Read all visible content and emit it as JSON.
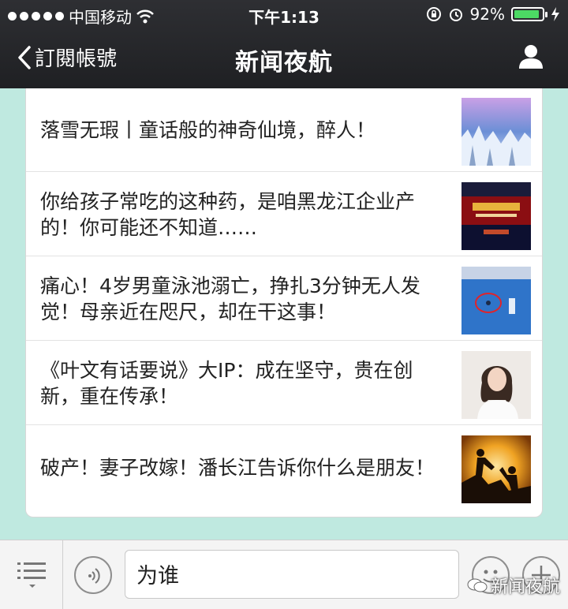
{
  "status_bar": {
    "carrier": "中国移动",
    "time": "下午1:13",
    "battery_percent_label": "92%",
    "battery_level": 0.92,
    "icons": [
      "signal-dots-icon",
      "wifi-icon",
      "rotation-lock-icon",
      "alarm-icon",
      "battery-icon",
      "charging-icon"
    ]
  },
  "nav": {
    "back_label": "訂閱帳號",
    "title": "新闻夜航",
    "right_icon": "person-icon"
  },
  "articles": [
    {
      "title": "落雪无瑕丨童话般的神奇仙境，醉人！",
      "thumb": "snowy-trees-image"
    },
    {
      "title": "你给孩子常吃的这种药，是咱黑龙江企业产的！你可能还不知道……",
      "thumb": "event-banner-image"
    },
    {
      "title": "痛心！4岁男童泳池溺亡，挣扎3分钟无人发觉！母亲近在咫尺，却在干这事！",
      "thumb": "swimming-pool-image"
    },
    {
      "title": "《叶文有话要说》大IP：成在坚守，贵在创新，重在传承！",
      "thumb": "woman-portrait-image"
    },
    {
      "title": "破产！妻子改嫁！潘长江告诉你什么是朋友！",
      "thumb": "silhouette-helping-hand-image"
    }
  ],
  "input_bar": {
    "input_value": "为谁",
    "icons": [
      "menu-icon",
      "voice-icon",
      "emoji-icon",
      "plus-icon"
    ]
  },
  "watermark": {
    "text": "新闻夜航"
  },
  "colors": {
    "topbar": "#26272a",
    "chat_background": "#bfe9e0",
    "battery_fill": "#4cd964"
  }
}
